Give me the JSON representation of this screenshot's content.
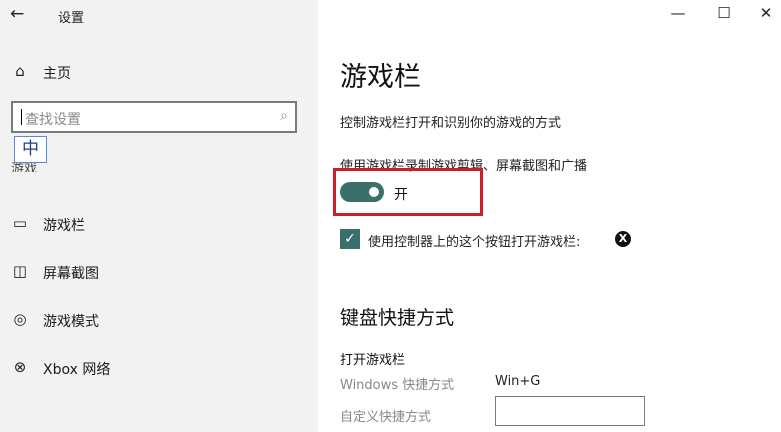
{
  "window": {
    "title": "设置",
    "back_icon": "←",
    "minimize_icon": "—",
    "maximize_icon": "☐",
    "close_icon": "✕"
  },
  "sidebar": {
    "home": {
      "icon": "⌂",
      "label": "主页"
    },
    "search": {
      "placeholder": "查找设置",
      "icon": "⌕"
    },
    "ime_indicator": "中",
    "section_label": "游戏",
    "items": [
      {
        "icon": "▭",
        "label": "游戏栏"
      },
      {
        "icon": "◫",
        "label": "屏幕截图"
      },
      {
        "icon": "◎",
        "label": "游戏模式"
      },
      {
        "icon": "⊗",
        "label": "Xbox 网络"
      }
    ]
  },
  "main": {
    "title": "游戏栏",
    "description": "控制游戏栏打开和识别你的游戏的方式",
    "record_label": "使用游戏栏录制游戏剪辑、屏幕截图和广播",
    "toggle": {
      "state_label": "开",
      "on": true
    },
    "checkbox": {
      "label": "使用控制器上的这个按钮打开游戏栏:",
      "checked": true,
      "check_icon": "✓",
      "xbox_icon": "X"
    },
    "keyboard_section": {
      "heading": "键盘快捷方式",
      "open_bar_label": "打开游戏栏",
      "windows_shortcut_label": "Windows 快捷方式",
      "windows_shortcut_value": "Win+G",
      "custom_shortcut_label": "自定义快捷方式",
      "custom_shortcut_value": ""
    }
  },
  "colors": {
    "accent": "#3c6f6b",
    "highlight_box": "#c62028",
    "sidebar_bg": "#f2f2f2"
  }
}
